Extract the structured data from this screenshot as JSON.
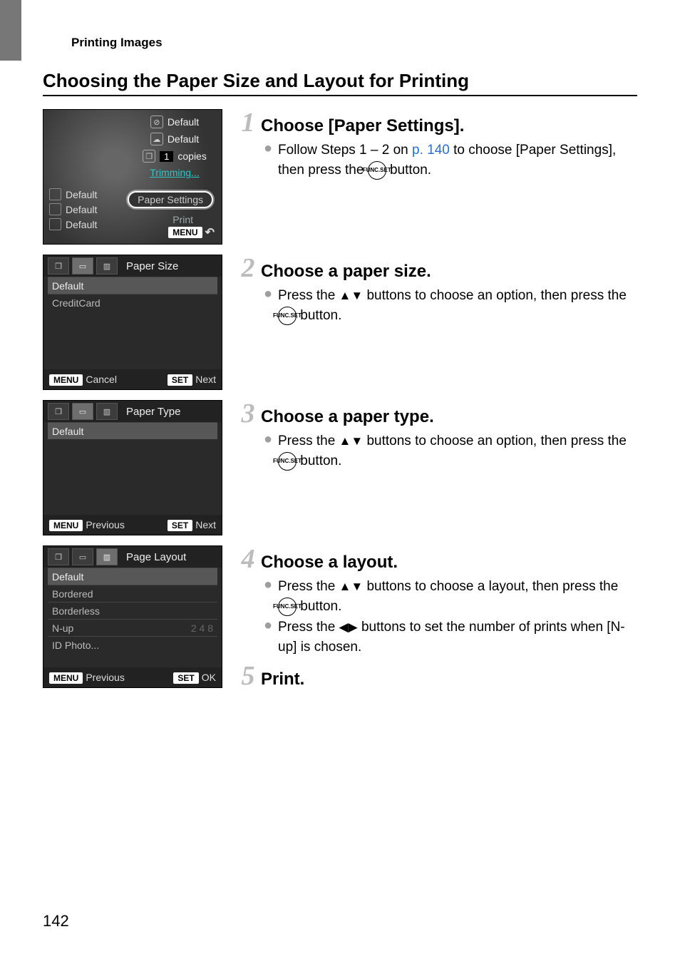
{
  "breadcrumb": "Printing Images",
  "heading": "Choosing the Paper Size and Layout for Printing",
  "page_number": "142",
  "link_page_ref": "p. 140",
  "func_button": {
    "top": "FUNC.",
    "bottom": "SET"
  },
  "shot1": {
    "set_date": "Default",
    "set_effect": "Default",
    "copies_value": "1",
    "copies_label": "copies",
    "trimming": "Trimming...",
    "left_defaults": [
      "Default",
      "Default",
      "Default"
    ],
    "paper_settings": "Paper Settings",
    "print": "Print",
    "menu": "MENU"
  },
  "shot2": {
    "title": "Paper Size",
    "items": [
      "Default",
      "CreditCard"
    ],
    "left": {
      "badge": "MENU",
      "text": "Cancel"
    },
    "right": {
      "badge": "SET",
      "text": "Next"
    }
  },
  "shot3": {
    "title": "Paper Type",
    "items": [
      "Default"
    ],
    "left": {
      "badge": "MENU",
      "text": "Previous"
    },
    "right": {
      "badge": "SET",
      "text": "Next"
    }
  },
  "shot4": {
    "title": "Page Layout",
    "items": [
      "Default",
      "Bordered",
      "Borderless",
      "N-up",
      "ID Photo..."
    ],
    "nup_value": "2 4 8",
    "left": {
      "badge": "MENU",
      "text": "Previous"
    },
    "right": {
      "badge": "SET",
      "text": "OK"
    }
  },
  "steps": {
    "s1": {
      "num": "1",
      "title": "Choose [Paper Settings].",
      "b1a": "Follow Steps 1 – 2 on ",
      "b1b": " to choose [Paper Settings], then press the ",
      "b1c": " button."
    },
    "s2": {
      "num": "2",
      "title": "Choose a paper size.",
      "b1a": "Press the ",
      "b1b": " buttons to choose an option, then press the ",
      "b1c": " button."
    },
    "s3": {
      "num": "3",
      "title": "Choose a paper type.",
      "b1a": "Press the ",
      "b1b": " buttons to choose an option, then press the ",
      "b1c": " button."
    },
    "s4": {
      "num": "4",
      "title": "Choose a layout.",
      "b1a": "Press the ",
      "b1b": " buttons to choose a layout, then press the ",
      "b1c": " button.",
      "b2a": "Press the ",
      "b2b": " buttons to set the number of prints when [N-up] is chosen."
    },
    "s5": {
      "num": "5",
      "title": "Print."
    }
  }
}
